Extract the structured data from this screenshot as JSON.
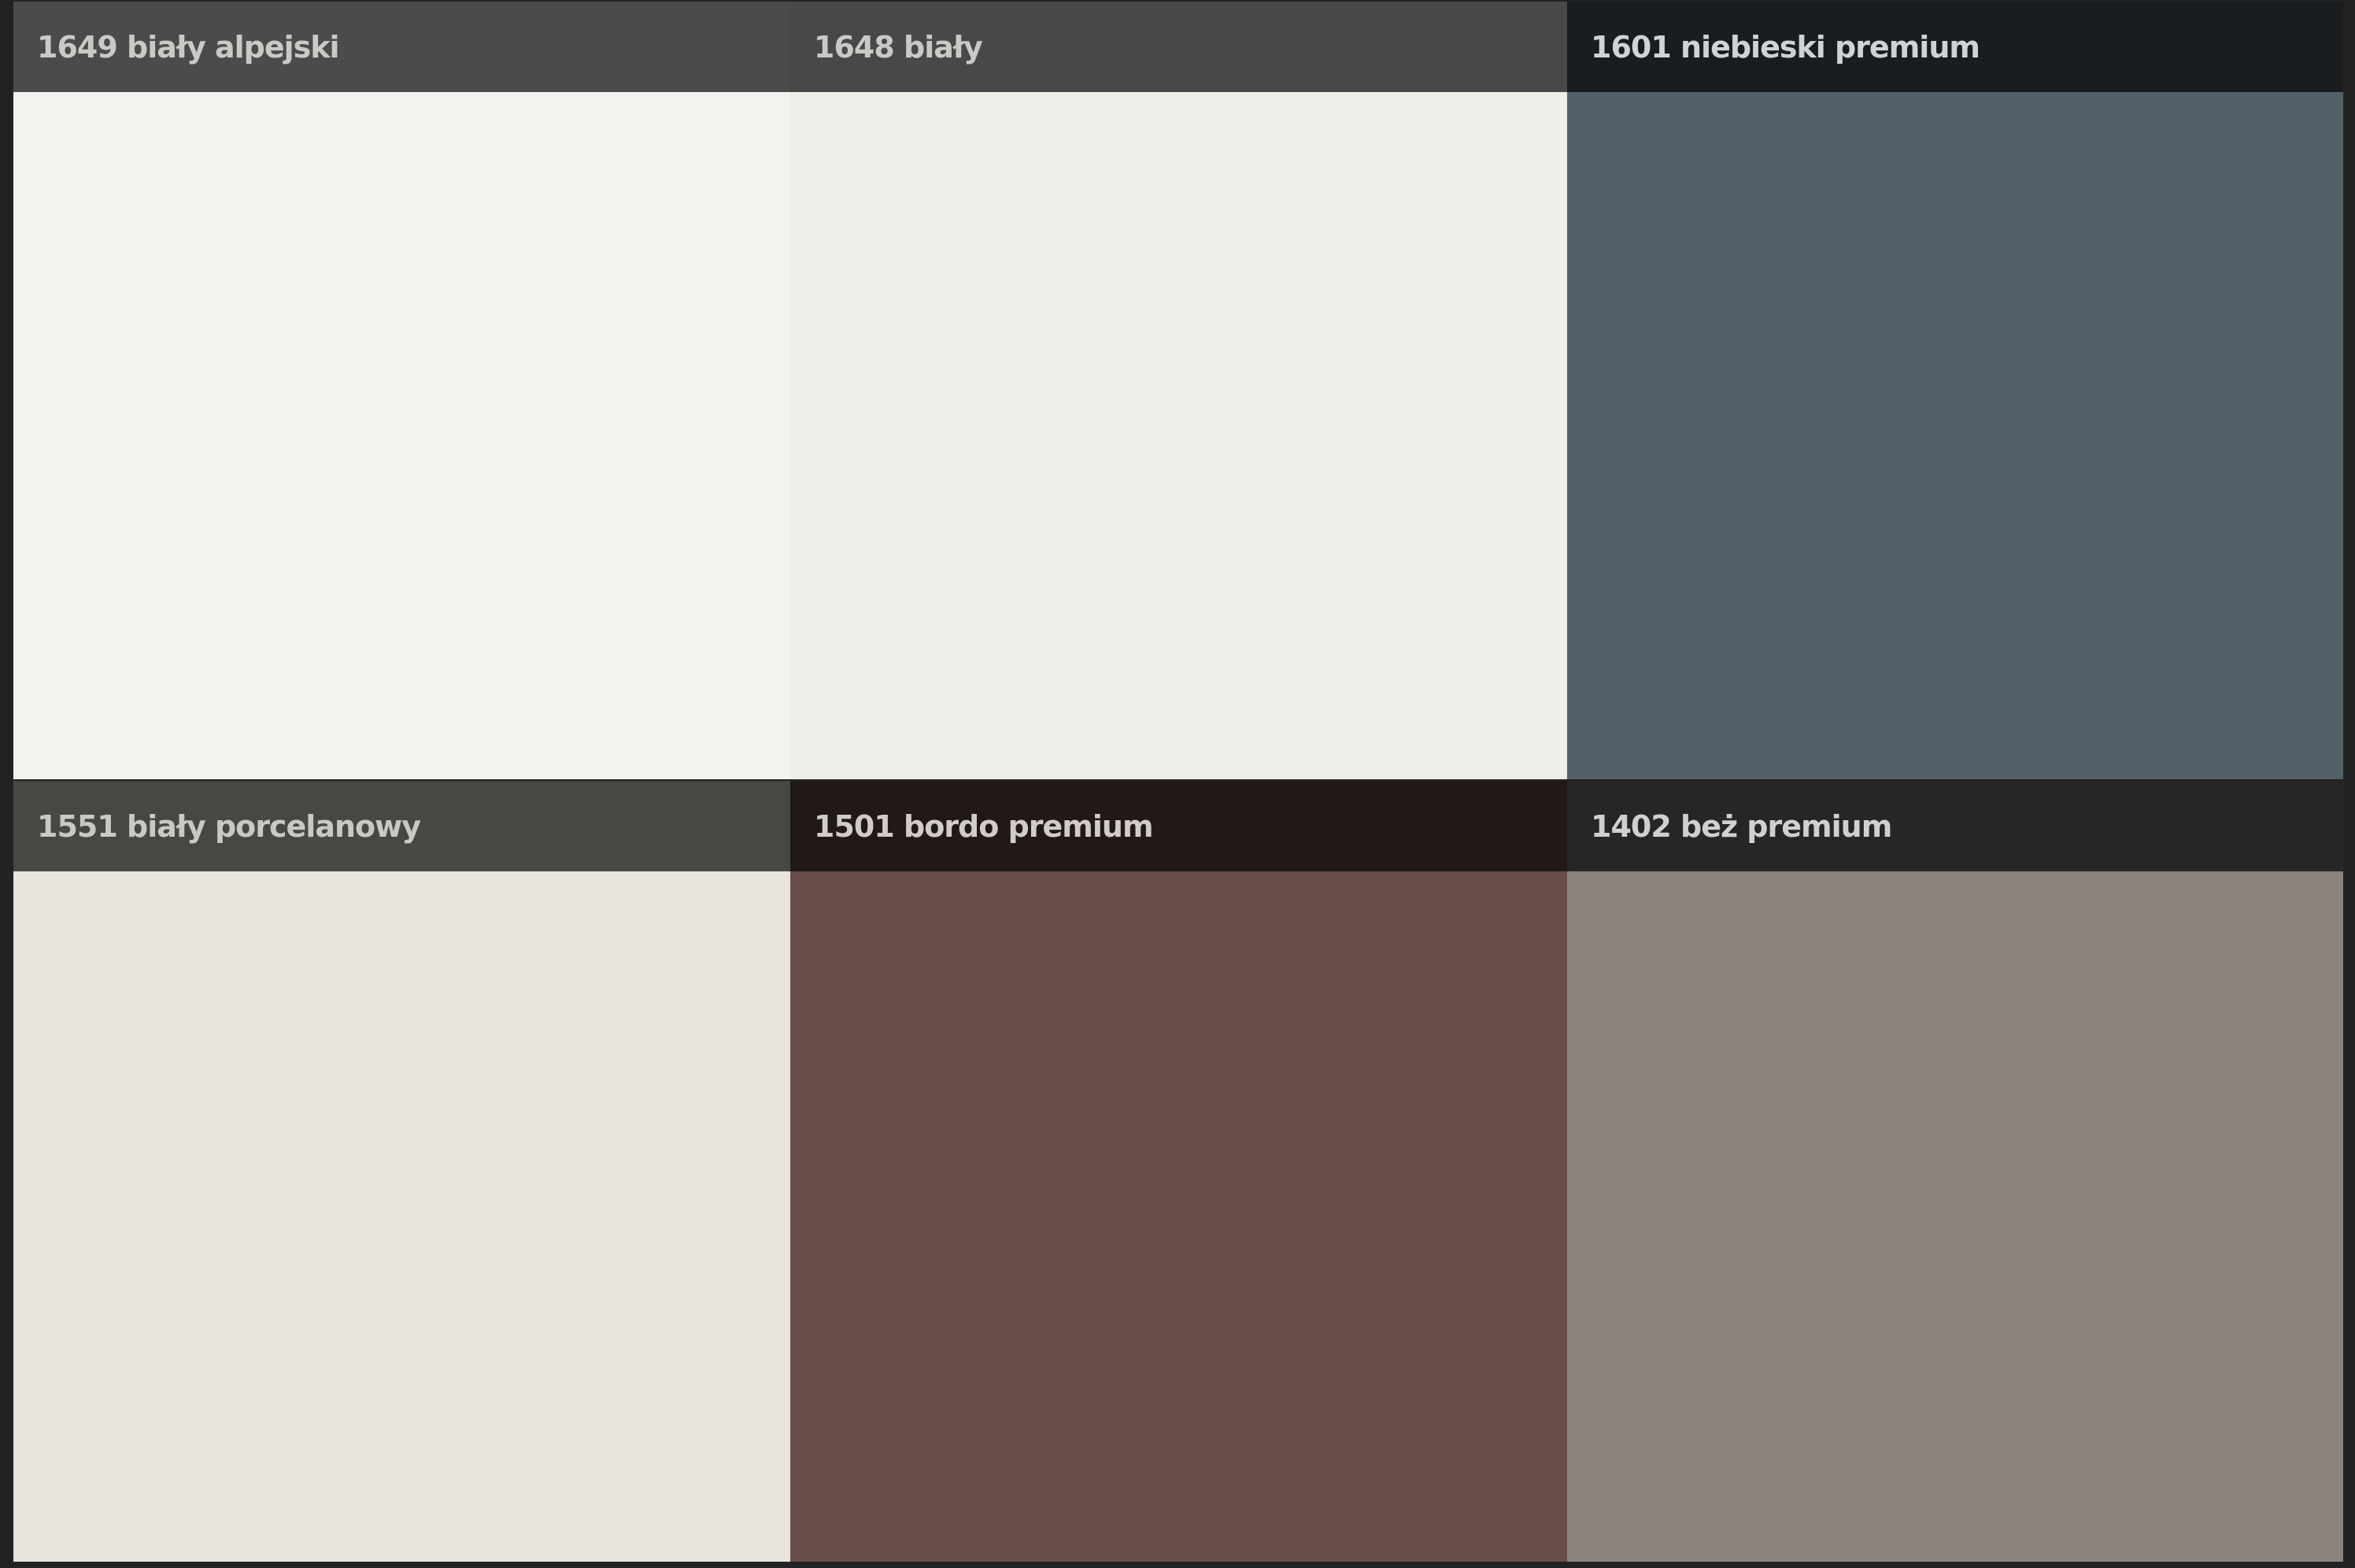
{
  "swatches": [
    {
      "label": "1649 biały alpejski",
      "header_color": "#4b4b4b",
      "text_color": "#c9c9c5",
      "swatch_color": "#f2f2ee"
    },
    {
      "label": "1648 biały",
      "header_color": "#484848",
      "text_color": "#c9c9c5",
      "swatch_color": "#eeefe8"
    },
    {
      "label": "1601 niebieski premium",
      "header_color": "#191d20",
      "text_color": "#cfd3d6",
      "swatch_color": "#526168"
    },
    {
      "label": "1551 biały porcelanowy",
      "header_color": "#474744",
      "text_color": "#c9c8c3",
      "swatch_color": "#e7e4de"
    },
    {
      "label": "1501 bordo premium",
      "header_color": "#211818",
      "text_color": "#d2cbcb",
      "swatch_color": "#6a4c4b"
    },
    {
      "label": "1402 beż premium",
      "header_color": "#262626",
      "text_color": "#d0d0d0",
      "swatch_color": "#8b837d"
    }
  ]
}
